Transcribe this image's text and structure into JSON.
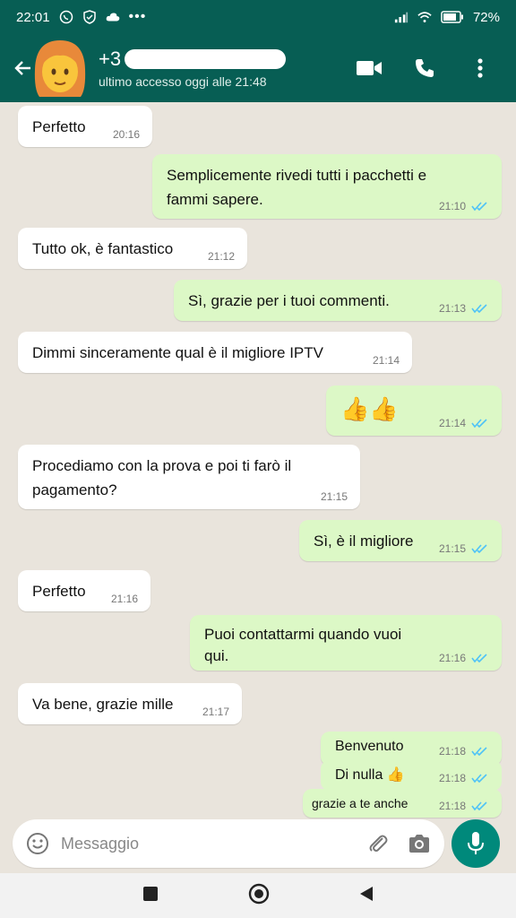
{
  "status_bar": {
    "time": "22:01",
    "battery": "72%"
  },
  "header": {
    "contact_name": "+3",
    "last_seen": "ultimo accesso oggi alle 21:48"
  },
  "messages": [
    {
      "text": "Perfetto",
      "time": "20:16"
    },
    {
      "text": "Semplicemente rivedi tutti i pacchetti e fammi sapere.",
      "time": "21:10"
    },
    {
      "text": "Tutto ok, è fantastico",
      "time": "21:12"
    },
    {
      "text": "Sì, grazie per i tuoi commenti.",
      "time": "21:13"
    },
    {
      "text": "Dimmi sinceramente qual è il migliore IPTV",
      "time": "21:14"
    },
    {
      "text": "👍👍",
      "time": "21:14"
    },
    {
      "text": "Procediamo con la prova e poi ti farò il pagamento?",
      "time": "21:15"
    },
    {
      "text": "Sì, è il migliore",
      "time": "21:15"
    },
    {
      "text": "Perfetto",
      "time": "21:16"
    },
    {
      "text": "Puoi contattarmi quando vuoi qui.",
      "time": "21:16"
    },
    {
      "text": "Va bene, grazie mille",
      "time": "21:17"
    },
    {
      "text": "Benvenuto",
      "time": "21:18"
    },
    {
      "text": "Di nulla 👍",
      "time": "21:18"
    },
    {
      "text": "grazie a te anche",
      "time": "21:18"
    }
  ],
  "composer": {
    "placeholder": "Messaggio"
  },
  "colors": {
    "header": "#075e54",
    "outgoing": "#dcf8c6",
    "incoming": "#ffffff",
    "tick": "#4fc3f7",
    "mic": "#00897b"
  }
}
